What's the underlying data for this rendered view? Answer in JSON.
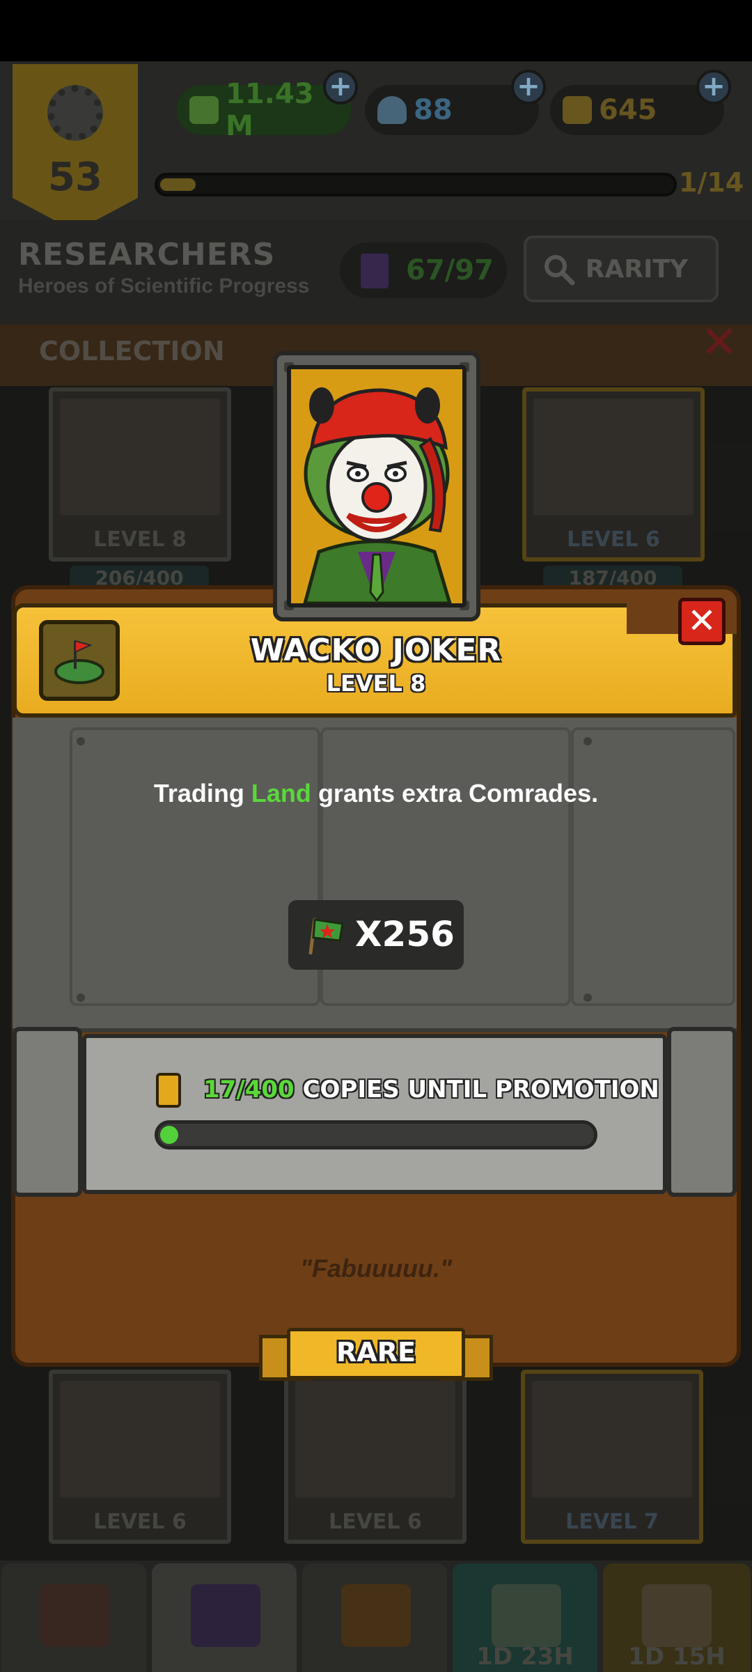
{
  "top_bar": {
    "player_level": "53",
    "money": "11.43 M",
    "flasks": "88",
    "gold": "645",
    "xp_progress": "1/14",
    "xp_fraction": 0.07
  },
  "section": {
    "title": "RESEARCHERS",
    "subtitle": "Heroes of Scientific Progress",
    "cards_count": "67/97",
    "rarity_button": "RARITY",
    "collection_label": "COLLECTION"
  },
  "background_cards": [
    {
      "level": "LEVEL 8",
      "progress": "206/400"
    },
    {
      "level": "LEVEL 6",
      "progress": "187/400"
    },
    {
      "level": "LEVEL 6"
    },
    {
      "level": "LEVEL 6"
    },
    {
      "level": "LEVEL 7"
    }
  ],
  "bottom_nav": {
    "timer_1": "1D 23H",
    "timer_2": "1D 15H"
  },
  "modal": {
    "name": "WACKO JOKER",
    "level": "LEVEL 8",
    "description_before": "Trading",
    "description_highlight": "Land",
    "description_after": "grants extra Comrades.",
    "reward_amount": "X256",
    "copies_count": "17/400",
    "copies_label": "COPIES UNTIL PROMOTION",
    "copies_fraction": 0.0425,
    "quote": "\"Fabuuuuu.\"",
    "rarity": "RARE"
  },
  "colors": {
    "header_gold": "#f0b828",
    "highlight_green": "#5ad83a",
    "close_red": "#d8261a",
    "frame_brown": "#6e3f16"
  }
}
